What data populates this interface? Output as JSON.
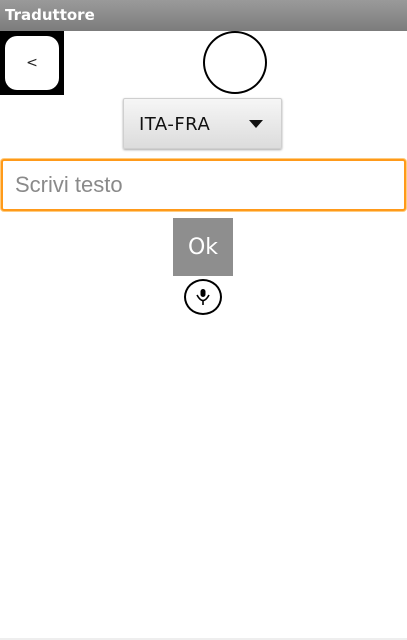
{
  "app": {
    "title": "Traduttore"
  },
  "nav": {
    "back_label": "<"
  },
  "language": {
    "selected": "ITA-FRA"
  },
  "input": {
    "placeholder": "Scrivi testo",
    "value": ""
  },
  "actions": {
    "ok_label": "Ok"
  },
  "icons": {
    "mic": "microphone-icon",
    "dropdown": "caret-down-icon",
    "avatar": "circle-icon"
  },
  "colors": {
    "title_bar": "#8a8a8a",
    "input_focus": "#ff9a1a",
    "ok_button": "#8e8e8e"
  }
}
